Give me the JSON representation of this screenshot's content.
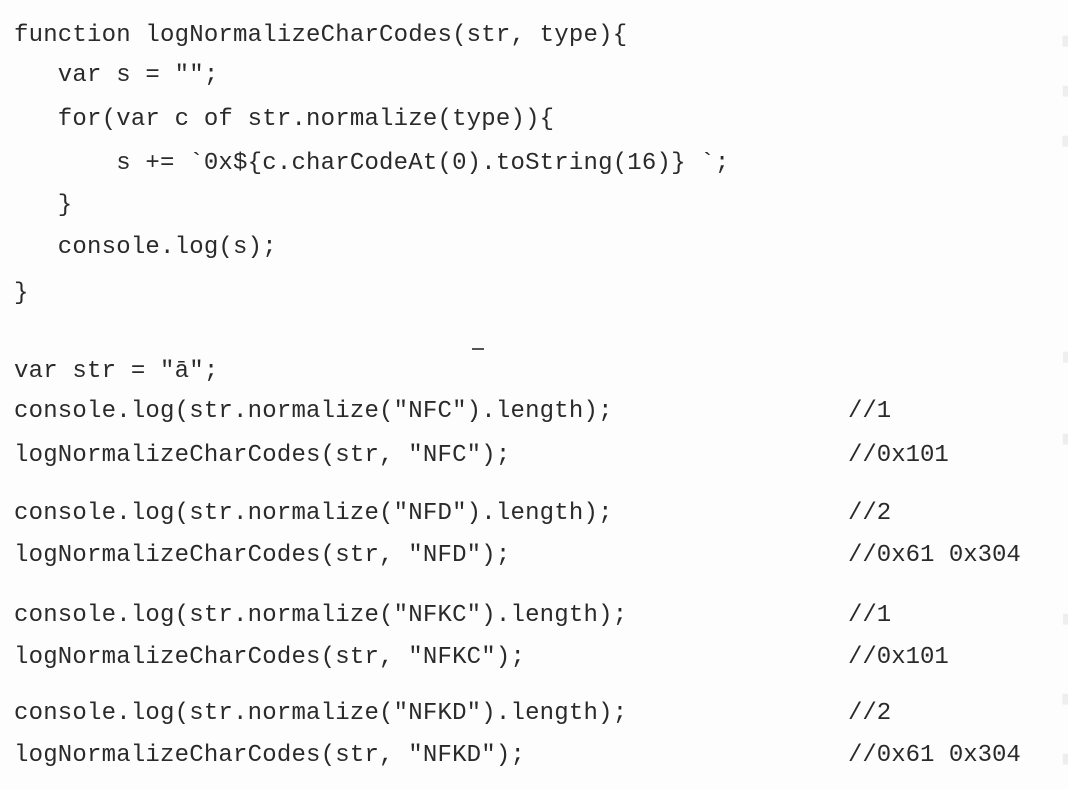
{
  "code": {
    "function_block": [
      "function logNormalizeCharCodes(str, type){",
      "   var s = \"\";",
      "   for(var c of str.normalize(type)){",
      "       s += `0x${c.charCodeAt(0).toString(16)} `;",
      "   }",
      "   console.log(s);",
      "}"
    ],
    "declaration": "var str = \"ā\";",
    "statements": [
      {
        "code": "console.log(str.normalize(\"NFC\").length);",
        "comment": "//1"
      },
      {
        "code": "logNormalizeCharCodes(str, \"NFC\");",
        "comment": "//0x101"
      },
      {
        "code": "console.log(str.normalize(\"NFD\").length);",
        "comment": "//2"
      },
      {
        "code": "logNormalizeCharCodes(str, \"NFD\");",
        "comment": "//0x61 0x304"
      },
      {
        "code": "console.log(str.normalize(\"NFKC\").length);",
        "comment": "//1"
      },
      {
        "code": "logNormalizeCharCodes(str, \"NFKC\");",
        "comment": "//0x101"
      },
      {
        "code": "console.log(str.normalize(\"NFKD\").length);",
        "comment": "//2"
      },
      {
        "code": "logNormalizeCharCodes(str, \"NFKD\");",
        "comment": "//0x61 0x304"
      }
    ]
  },
  "colors": {
    "page_background": "#fdfdfd",
    "code_text": "#2a2a2a",
    "bleed_through": "rgba(40,40,40,0.07)"
  }
}
